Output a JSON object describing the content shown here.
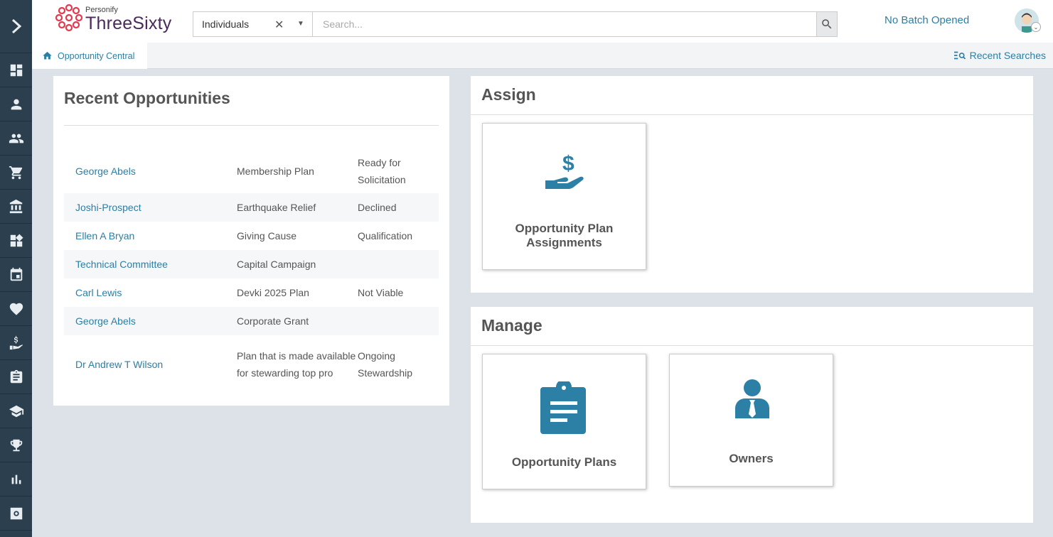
{
  "header": {
    "logo_small": "Personify",
    "logo_big": "ThreeSixty",
    "search_type": "Individuals",
    "search_placeholder": "Search...",
    "batch_status": "No Batch Opened"
  },
  "tabs": {
    "active_tab": "Opportunity Central",
    "recent_searches": "Recent Searches"
  },
  "recent_opportunities": {
    "title": "Recent Opportunities",
    "rows": [
      {
        "name": "George Abels",
        "plan": "Membership Plan",
        "stage": "Ready for Solicitation"
      },
      {
        "name": "Joshi-Prospect",
        "plan": "Earthquake Relief",
        "stage": "Declined"
      },
      {
        "name": "Ellen A Bryan",
        "plan": "Giving Cause",
        "stage": "Qualification"
      },
      {
        "name": "Technical Committee",
        "plan": "Capital Campaign",
        "stage": ""
      },
      {
        "name": "Carl Lewis",
        "plan": "Devki 2025 Plan",
        "stage": "Not Viable"
      },
      {
        "name": "George Abels",
        "plan": "Corporate Grant",
        "stage": ""
      },
      {
        "name": "Dr Andrew T Wilson",
        "plan": "Plan that is made available for stewarding top pro",
        "stage": "Ongoing Stewardship"
      }
    ]
  },
  "assign": {
    "title": "Assign",
    "tiles": [
      {
        "label": "Opportunity Plan Assignments",
        "icon": "hand-dollar-icon"
      }
    ]
  },
  "manage": {
    "title": "Manage",
    "tiles": [
      {
        "label": "Opportunity Plans",
        "icon": "clipboard-icon"
      },
      {
        "label": "Owners",
        "icon": "person-tie-icon"
      }
    ]
  },
  "sidebar": {
    "icons": [
      "chevron-right-icon",
      "dashboard-icon",
      "person-icon",
      "group-icon",
      "cart-icon",
      "bank-icon",
      "widgets-icon",
      "calendar-icon",
      "heart-icon",
      "hand-dollar-icon",
      "clipboard-icon",
      "graduation-cap-icon",
      "trophy-icon",
      "bar-chart-icon",
      "settings-icon"
    ]
  },
  "colors": {
    "sidebar_bg": "#2b3f4e",
    "accent": "#2a7fa6",
    "icon_fill": "#2c7fa5",
    "page_bg": "#dde2e8",
    "logo_red": "#e03a4f"
  }
}
